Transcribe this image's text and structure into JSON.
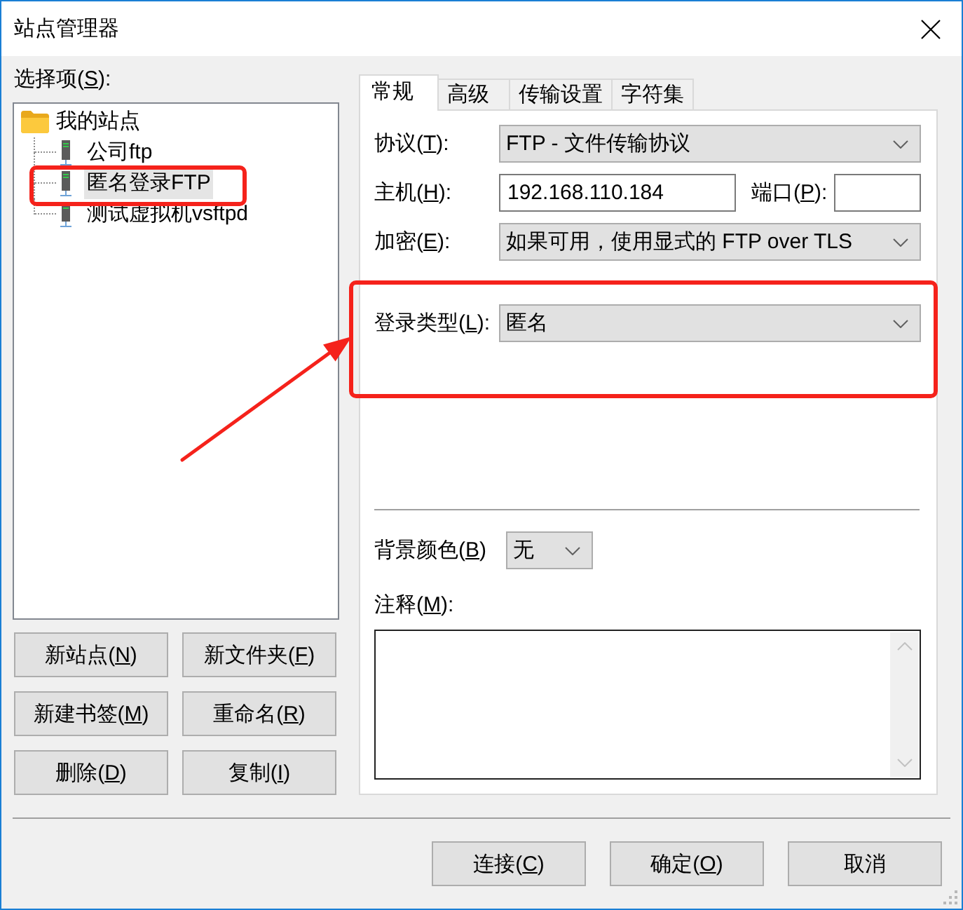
{
  "window": {
    "title": "站点管理器"
  },
  "site_tree": {
    "label": "选择项(S):",
    "items": [
      {
        "label": "我的站点",
        "kind": "folder",
        "selected": false,
        "children": [
          {
            "label": "公司ftp",
            "kind": "site",
            "selected": false
          },
          {
            "label": "匿名登录FTP",
            "kind": "site",
            "selected": true
          },
          {
            "label": "测试虚拟机vsftpd",
            "kind": "site",
            "selected": false
          }
        ]
      }
    ]
  },
  "site_buttons": [
    {
      "label": "新站点(N)"
    },
    {
      "label": "新文件夹(F)"
    },
    {
      "label": "新建书签(M)"
    },
    {
      "label": "重命名(R)"
    },
    {
      "label": "删除(D)"
    },
    {
      "label": "复制(I)"
    }
  ],
  "tabs": [
    {
      "label": "常规",
      "selected": true
    },
    {
      "label": "高级",
      "selected": false
    },
    {
      "label": "传输设置",
      "selected": false
    },
    {
      "label": "字符集",
      "selected": false
    }
  ],
  "general": {
    "protocol": {
      "label": "协议(T):",
      "value": "FTP - 文件传输协议"
    },
    "host": {
      "label": "主机(H):",
      "value": "192.168.110.184"
    },
    "port": {
      "label": "端口(P):"
    },
    "encryption": {
      "label": "加密(E):",
      "value": "如果可用，使用显式的 FTP over TLS"
    },
    "logon_type": {
      "label": "登录类型(L):",
      "value": "匿名"
    },
    "background_color": {
      "label": "背景颜色(B)",
      "value": "无"
    },
    "comments": {
      "label": "注释(M):"
    }
  },
  "dialog_buttons": [
    {
      "label": "连接(C)"
    },
    {
      "label": "确定(O)"
    },
    {
      "label": "取消"
    }
  ]
}
